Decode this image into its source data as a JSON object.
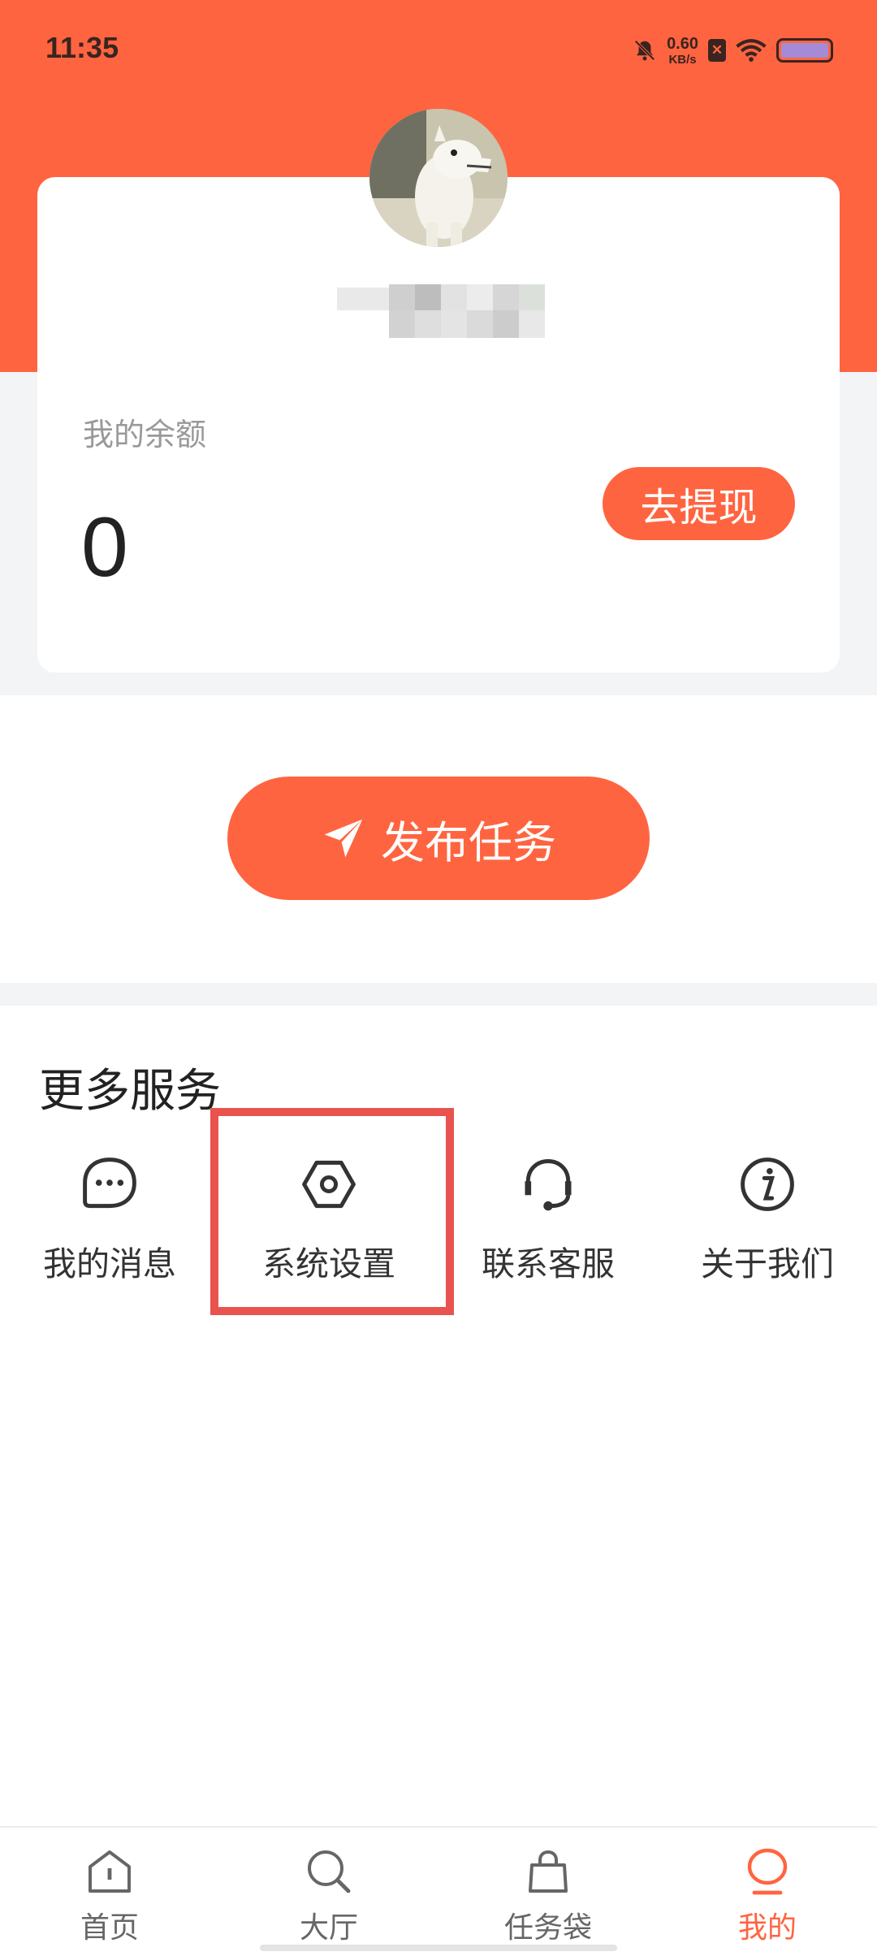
{
  "status_bar": {
    "time": "11:35",
    "net_speed_value": "0.60",
    "net_speed_unit": "KB/s",
    "icons": [
      "bell-mute-icon",
      "sim-x-icon",
      "wifi-icon",
      "battery-icon"
    ]
  },
  "profile": {
    "balance_label": "我的余额",
    "balance_value": "0",
    "withdraw_label": "去提现"
  },
  "publish_label": "发布任务",
  "more_services": {
    "title": "更多服务",
    "items": [
      {
        "label": "我的消息",
        "icon": "message-icon"
      },
      {
        "label": "系统设置",
        "icon": "settings-icon"
      },
      {
        "label": "联系客服",
        "icon": "headset-icon"
      },
      {
        "label": "关于我们",
        "icon": "info-icon"
      }
    ]
  },
  "bottom_nav": {
    "items": [
      {
        "label": "首页",
        "icon": "home-icon",
        "active": false
      },
      {
        "label": "大厅",
        "icon": "search-icon",
        "active": false
      },
      {
        "label": "任务袋",
        "icon": "bag-icon",
        "active": false
      },
      {
        "label": "我的",
        "icon": "profile-icon",
        "active": true
      }
    ]
  },
  "colors": {
    "accent": "#ff6440",
    "highlight": "#e9534e",
    "background_gray": "#f3f4f6"
  }
}
